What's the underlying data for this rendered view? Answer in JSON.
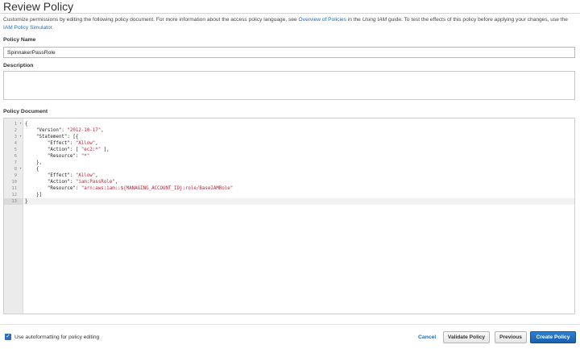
{
  "page": {
    "title": "Review Policy",
    "intro": {
      "part1": "Customize permissions by editing the following policy document. For more information about the access policy language, see ",
      "link1": "Overview of Policies",
      "part2": " in the ",
      "em": "Using IAM",
      "part3": " guide. To test the effects of this policy before applying your changes, use the ",
      "link2": "IAM Policy Simulator",
      "part4": "."
    }
  },
  "form": {
    "policy_name_label": "Policy Name",
    "policy_name_value": "SpinnakerPassRole",
    "description_label": "Description",
    "description_value": "",
    "policy_document_label": "Policy Document"
  },
  "editor": {
    "active_line": 13,
    "lines": [
      {
        "n": "1",
        "fold": true,
        "segs": [
          {
            "t": "{",
            "c": "key"
          }
        ]
      },
      {
        "n": "2",
        "fold": false,
        "segs": [
          {
            "t": "    \"Version\": ",
            "c": "key"
          },
          {
            "t": "\"2012-10-17\"",
            "c": "str"
          },
          {
            "t": ",",
            "c": "key"
          }
        ]
      },
      {
        "n": "3",
        "fold": true,
        "segs": [
          {
            "t": "    \"Statement\": [{",
            "c": "key"
          }
        ]
      },
      {
        "n": "4",
        "fold": false,
        "segs": [
          {
            "t": "        \"Effect\": ",
            "c": "key"
          },
          {
            "t": "\"Allow\"",
            "c": "str"
          },
          {
            "t": ",",
            "c": "key"
          }
        ]
      },
      {
        "n": "5",
        "fold": false,
        "segs": [
          {
            "t": "        \"Action\": [ ",
            "c": "key"
          },
          {
            "t": "\"ec2:*\"",
            "c": "str"
          },
          {
            "t": " ],",
            "c": "key"
          }
        ]
      },
      {
        "n": "6",
        "fold": false,
        "segs": [
          {
            "t": "        \"Resource\": ",
            "c": "key"
          },
          {
            "t": "\"*\"",
            "c": "str"
          }
        ]
      },
      {
        "n": "7",
        "fold": false,
        "segs": [
          {
            "t": "    },",
            "c": "key"
          }
        ]
      },
      {
        "n": "8",
        "fold": true,
        "segs": [
          {
            "t": "    {",
            "c": "key"
          }
        ]
      },
      {
        "n": "9",
        "fold": false,
        "segs": [
          {
            "t": "        \"Effect\": ",
            "c": "key"
          },
          {
            "t": "\"Allow\"",
            "c": "str"
          },
          {
            "t": ",",
            "c": "key"
          }
        ]
      },
      {
        "n": "10",
        "fold": false,
        "segs": [
          {
            "t": "        \"Action\": ",
            "c": "key"
          },
          {
            "t": "\"iam:PassRole\"",
            "c": "str"
          },
          {
            "t": ",",
            "c": "key"
          }
        ]
      },
      {
        "n": "11",
        "fold": false,
        "segs": [
          {
            "t": "        \"Resource\": ",
            "c": "key"
          },
          {
            "t": "\"arn:aws:iam::${MANAGING_ACCOUNT_ID}:role/BaseIAMRole\"",
            "c": "str"
          }
        ]
      },
      {
        "n": "12",
        "fold": false,
        "segs": [
          {
            "t": "    }]",
            "c": "key"
          }
        ]
      },
      {
        "n": "13",
        "fold": false,
        "segs": [
          {
            "t": "}",
            "c": "key"
          }
        ]
      }
    ]
  },
  "footer": {
    "autoformat_checked": true,
    "autoformat_label": "Use autoformatting for policy editing",
    "cancel_label": "Cancel",
    "validate_label": "Validate Policy",
    "previous_label": "Previous",
    "create_label": "Create Policy"
  },
  "colors": {
    "link": "#1f6db5",
    "string": "#b5283a",
    "primary_button": "#1b5fae"
  }
}
